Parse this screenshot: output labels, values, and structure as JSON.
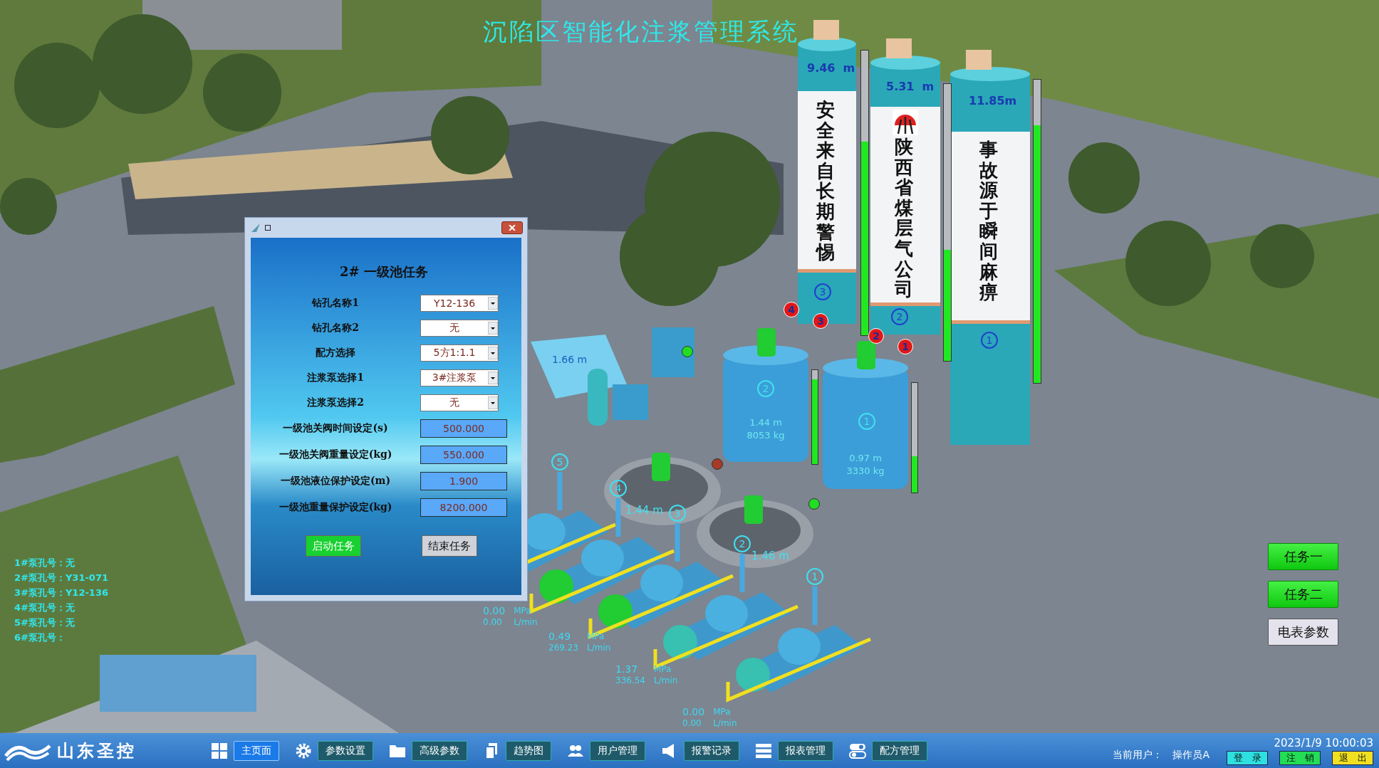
{
  "title": "沉陷区智能化注浆管理系统",
  "silos": [
    {
      "number": "3",
      "reading": "9.46  m",
      "slogan": "安全来自长期警惕",
      "logo": false,
      "level": 0.68
    },
    {
      "number": "2",
      "reading": "5.31  m",
      "slogan": "陕西省煤层气公司",
      "logo": true,
      "level": 0.4
    },
    {
      "number": "1",
      "reading": "11.85m",
      "slogan": "事故源于瞬间麻痹",
      "logo": false,
      "level": 0.85
    }
  ],
  "valve_markers": [
    "4",
    "3",
    "2",
    "1"
  ],
  "water_tank": {
    "depth": "1.66 m"
  },
  "tanks": [
    {
      "number": "2",
      "depth": "1.44 m",
      "weight": "8053 kg",
      "level": 0.9
    },
    {
      "number": "1",
      "depth": "0.97 m",
      "weight": "3330 kg",
      "level": 0.33
    }
  ],
  "pools": [
    {
      "depth": "1.44 m"
    },
    {
      "depth": "1.46 m"
    }
  ],
  "valves": [
    {
      "color": "#22dd22"
    },
    {
      "color": "#a83a2a"
    },
    {
      "color": "#22dd22"
    }
  ],
  "pumps": [
    {
      "number": "5"
    },
    {
      "number": "4"
    },
    {
      "number": "3"
    },
    {
      "number": "2"
    },
    {
      "number": "1"
    }
  ],
  "pump_readings": [
    {
      "pressure": "0.00",
      "pressure_unit": "MPa",
      "flow": "0.00",
      "flow_unit": "L/min"
    },
    {
      "pressure": "0.49",
      "pressure_unit": "MPa",
      "flow": "269.23",
      "flow_unit": "L/min"
    },
    {
      "pressure": "1.37",
      "pressure_unit": "MPa",
      "flow": "336.54",
      "flow_unit": "L/min"
    },
    {
      "pressure": "0.00",
      "pressure_unit": "MPa",
      "flow": "0.00",
      "flow_unit": "L/min"
    }
  ],
  "pump_holes": [
    "1#泵孔号：无",
    "2#泵孔号：Y31-071",
    "3#泵孔号：Y12-136",
    "4#泵孔号：无",
    "5#泵孔号：无",
    "6#泵孔号："
  ],
  "dialog": {
    "heading": "2# 一级池任务",
    "fields": [
      {
        "label": "钻孔名称1",
        "value": "Y12-136",
        "kind": "dropdown"
      },
      {
        "label": "钻孔名称2",
        "value": "无",
        "kind": "dropdown"
      },
      {
        "label": "配方选择",
        "value": "5方1:1.1",
        "kind": "dropdown"
      },
      {
        "label": "注浆泵选择1",
        "value": "3#注浆泵",
        "kind": "dropdown"
      },
      {
        "label": "注浆泵选择2",
        "value": "无",
        "kind": "dropdown"
      },
      {
        "label": "一级池关阀时间设定(s)",
        "value": "500.000",
        "kind": "number"
      },
      {
        "label": "一级池关阀重量设定(kg)",
        "value": "550.000",
        "kind": "number"
      },
      {
        "label": "一级池液位保护设定(m)",
        "value": "1.900",
        "kind": "number"
      },
      {
        "label": "一级池重量保护设定(kg)",
        "value": "8200.000",
        "kind": "number"
      }
    ],
    "buttons": [
      {
        "label": "启动任务",
        "active": true
      },
      {
        "label": "结束任务",
        "active": false
      }
    ]
  },
  "side_buttons": [
    {
      "label": "任务一",
      "active": true
    },
    {
      "label": "任务二",
      "active": true
    },
    {
      "label": "电表参数",
      "active": false
    }
  ],
  "taskbar": {
    "logo": "山东圣控",
    "nav": [
      {
        "label": "主页面",
        "selected": true
      },
      {
        "label": "参数设置",
        "selected": false
      },
      {
        "label": "高级参数",
        "selected": false
      },
      {
        "label": "趋势图",
        "selected": false
      },
      {
        "label": "用户管理",
        "selected": false
      },
      {
        "label": "报警记录",
        "selected": false
      },
      {
        "label": "报表管理",
        "selected": false
      },
      {
        "label": "配方管理",
        "selected": false
      }
    ],
    "user_label": "当前用户：",
    "user": "操作员A",
    "datetime": "2023/1/9 10:00:03",
    "buttons": [
      {
        "label": "登　录",
        "color": "#2ee0e0"
      },
      {
        "label": "注　销",
        "color": "#22dd55"
      },
      {
        "label": "退　出",
        "color": "#f0e020"
      }
    ]
  }
}
